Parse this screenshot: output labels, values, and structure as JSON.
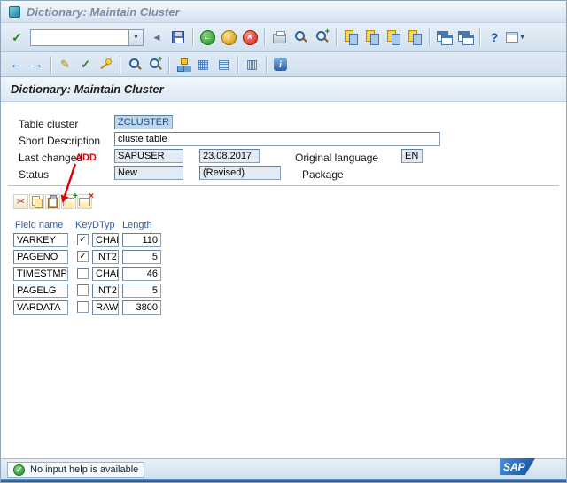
{
  "window": {
    "title": "Dictionary: Maintain Cluster"
  },
  "screen": {
    "title": "Dictionary: Maintain Cluster"
  },
  "standard_toolbar": {
    "command_value": ""
  },
  "form": {
    "table_cluster_label": "Table cluster",
    "table_cluster_value": "ZCLUSTER",
    "short_description_label": "Short Description",
    "short_description_value": "cluste table",
    "last_changed_label": "Last changed",
    "last_changed_user": "SAPUSER",
    "last_changed_date": "23.08.2017",
    "original_language_label": "Original language",
    "original_language_value": "EN",
    "status_label": "Status",
    "status_value": "New",
    "status_revised": "(Revised)",
    "package_label": "Package"
  },
  "annotation": {
    "label": "ADD"
  },
  "fields_table": {
    "headers": {
      "field_name": "Field name",
      "key": "Key",
      "dtyp": "DTyp",
      "length": "Length"
    },
    "rows": [
      {
        "field_name": "VARKEY",
        "key": true,
        "key_glyph": "✓",
        "dtyp": "CHAR",
        "length": "110"
      },
      {
        "field_name": "PAGENO",
        "key": true,
        "key_glyph": "✓",
        "dtyp": "INT2",
        "length": "5"
      },
      {
        "field_name": "TIMESTMP",
        "key": false,
        "key_glyph": "",
        "dtyp": "CHAR",
        "length": "46"
      },
      {
        "field_name": "PAGELG",
        "key": false,
        "key_glyph": "",
        "dtyp": "INT2",
        "length": "5"
      },
      {
        "field_name": "VARDATA",
        "key": false,
        "key_glyph": "",
        "dtyp": "RAW",
        "length": "3800"
      }
    ]
  },
  "status_bar": {
    "message": "No input help is available"
  },
  "branding": {
    "logo": "SAP"
  },
  "icons": {
    "enter": "✓",
    "dropdown": "▼",
    "collapse": "◀",
    "back": "←",
    "exit": "↑",
    "cancel": "×",
    "plus": "+",
    "help": "?",
    "nav_back": "←",
    "nav_forward": "→",
    "pencil": "✎",
    "check": "✓",
    "cut": "✂",
    "grid": "▦",
    "grid_rows": "▤",
    "grid_cols": "▥",
    "info": "i",
    "status_check": "✓"
  }
}
